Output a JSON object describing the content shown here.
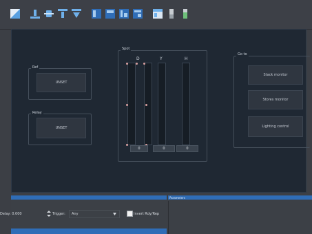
{
  "toolbar": {
    "icons": [
      "color-swatch-icon",
      "align-bottom-icon",
      "align-center-icon",
      "align-top-icon",
      "distribute-icon",
      "layout-a-icon",
      "layout-b-icon",
      "layout-c-icon",
      "layout-d-icon",
      "panel-icon",
      "slim-bar-icon",
      "bar-fill-icon"
    ]
  },
  "main": {
    "group_ref": {
      "title": "Ref",
      "button": "UNSET"
    },
    "group_relay": {
      "title": "Relay",
      "button": "UNSET"
    },
    "group_spot": {
      "title": "Spot",
      "columns": [
        {
          "label": "D",
          "value": "0"
        },
        {
          "label": "Y",
          "value": "0"
        },
        {
          "label": "H",
          "value": "0"
        }
      ]
    },
    "group_goto": {
      "title": "Go to",
      "buttons": [
        "Stack monitor",
        "Stores monitor",
        "Lighting control"
      ]
    }
  },
  "bottom": {
    "left": {
      "delay_label": "Delay: 0.000",
      "trigger_label": "Trigger:",
      "trigger_value": "Any",
      "checkbox_label": "Invert Rdy/Rep"
    },
    "right": {
      "header": "Parameters"
    }
  },
  "colors": {
    "accent_blue": "#2f6db7",
    "panel_bg": "#1f2833",
    "fader_marker": "#d9a0a0"
  }
}
